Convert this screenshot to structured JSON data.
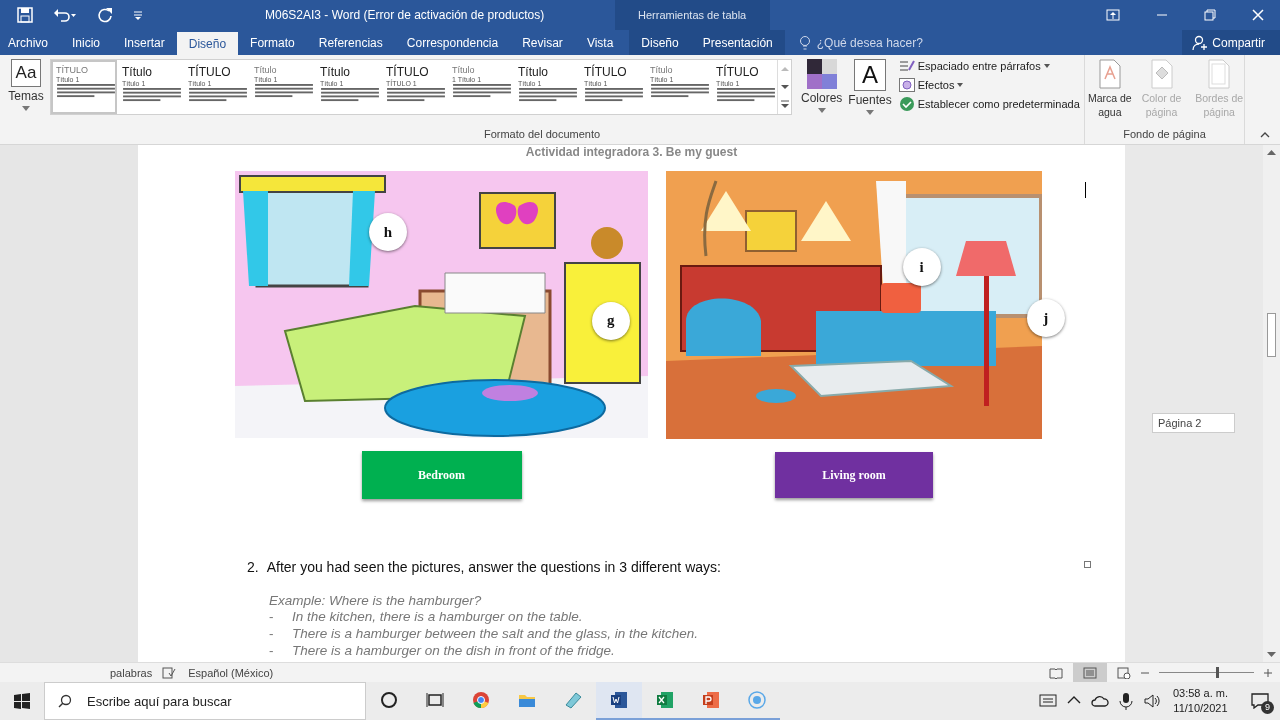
{
  "window": {
    "title": "M06S2AI3 - Word (Error de activación de productos)",
    "context_group": "Herramientas de tabla"
  },
  "tabs": [
    {
      "label": "Archivo",
      "selected": false,
      "kind": "file"
    },
    {
      "label": "Inicio",
      "selected": false,
      "kind": "main"
    },
    {
      "label": "Insertar",
      "selected": false,
      "kind": "main"
    },
    {
      "label": "Diseño",
      "selected": true,
      "kind": "main"
    },
    {
      "label": "Formato",
      "selected": false,
      "kind": "main"
    },
    {
      "label": "Referencias",
      "selected": false,
      "kind": "main"
    },
    {
      "label": "Correspondencia",
      "selected": false,
      "kind": "main"
    },
    {
      "label": "Revisar",
      "selected": false,
      "kind": "main"
    },
    {
      "label": "Vista",
      "selected": false,
      "kind": "main"
    },
    {
      "label": "Diseño",
      "selected": false,
      "kind": "context"
    },
    {
      "label": "Presentación",
      "selected": false,
      "kind": "context"
    }
  ],
  "tell_me": {
    "placeholder": "¿Qué desea hacer?"
  },
  "share": {
    "label": "Compartir"
  },
  "ribbon": {
    "themes": {
      "glyph": "Aa",
      "label": "Temas"
    },
    "style_gallery": [
      {
        "title": "TÍTULO",
        "heading": "Título 1",
        "selected": true
      },
      {
        "title": "Título",
        "heading": "Título 1",
        "selected": false
      },
      {
        "title": "TÍTULO",
        "heading": "Título 1",
        "selected": false
      },
      {
        "title": "Título",
        "heading": "Título 1",
        "selected": false
      },
      {
        "title": "Título",
        "heading": "Título 1",
        "selected": false
      },
      {
        "title": "TÍTULO",
        "heading": "TÍTULO 1",
        "selected": false
      },
      {
        "title": "Título",
        "heading": "1 Título 1",
        "selected": false
      },
      {
        "title": "Título",
        "heading": "Título 1",
        "selected": false
      },
      {
        "title": "TÍTULO",
        "heading": "Título 1",
        "selected": false
      },
      {
        "title": "Título",
        "heading": "Título 1",
        "selected": false
      },
      {
        "title": "TÍTULO",
        "heading": "Título 1",
        "selected": false
      }
    ],
    "colors": {
      "label": "Colores"
    },
    "fonts": {
      "glyph": "A",
      "label": "Fuentes"
    },
    "commands": [
      {
        "label": "Espaciado entre párrafos",
        "kind": "spacing",
        "dropdown": true
      },
      {
        "label": "Efectos",
        "kind": "effects",
        "dropdown": true
      },
      {
        "label": "Establecer como predeterminada",
        "kind": "default",
        "dropdown": false
      }
    ],
    "format_group_label": "Formato del documento",
    "page_background": [
      {
        "label": "Marca de agua",
        "disabled": false
      },
      {
        "label": "Color de página",
        "disabled": true
      },
      {
        "label": "Bordes de página",
        "disabled": true
      }
    ],
    "background_group_label": "Fondo de página"
  },
  "document": {
    "heading": "Actividad integradora 3. Be my guest",
    "pictures": [
      {
        "kind": "picture",
        "markers": [
          {
            "label": "h"
          },
          {
            "label": "g"
          }
        ],
        "button": {
          "label": "Bedroom",
          "color": "#00b050"
        }
      },
      {
        "kind": "picture",
        "markers": [
          {
            "label": "i"
          },
          {
            "label": "j"
          }
        ],
        "button": {
          "label": "Living room",
          "color": "#7030a0"
        }
      }
    ],
    "question": {
      "number": "2.",
      "text": "After you had seen the pictures, answer the questions in 3 different ways:"
    },
    "example": "Example: Where is the hamburger?",
    "answers": [
      {
        "bullet": "-",
        "text": "In the kitchen, there is a hamburger on the table."
      },
      {
        "bullet": "-",
        "text": "There is a hamburger between the salt and the glass, in the kitchen."
      },
      {
        "bullet": "-",
        "text": "There is a hamburger on the dish in front of the fridge."
      }
    ]
  },
  "page_tooltip": "Página 2",
  "status_bar": {
    "words": "palabras",
    "language": "Español (México)",
    "zoom": {
      "level": 0.6
    }
  },
  "taskbar": {
    "search": {
      "placeholder": "Escribe aquí para buscar"
    },
    "time": "03:58 a. m.",
    "date": "11/10/2021",
    "notifications": "9"
  }
}
